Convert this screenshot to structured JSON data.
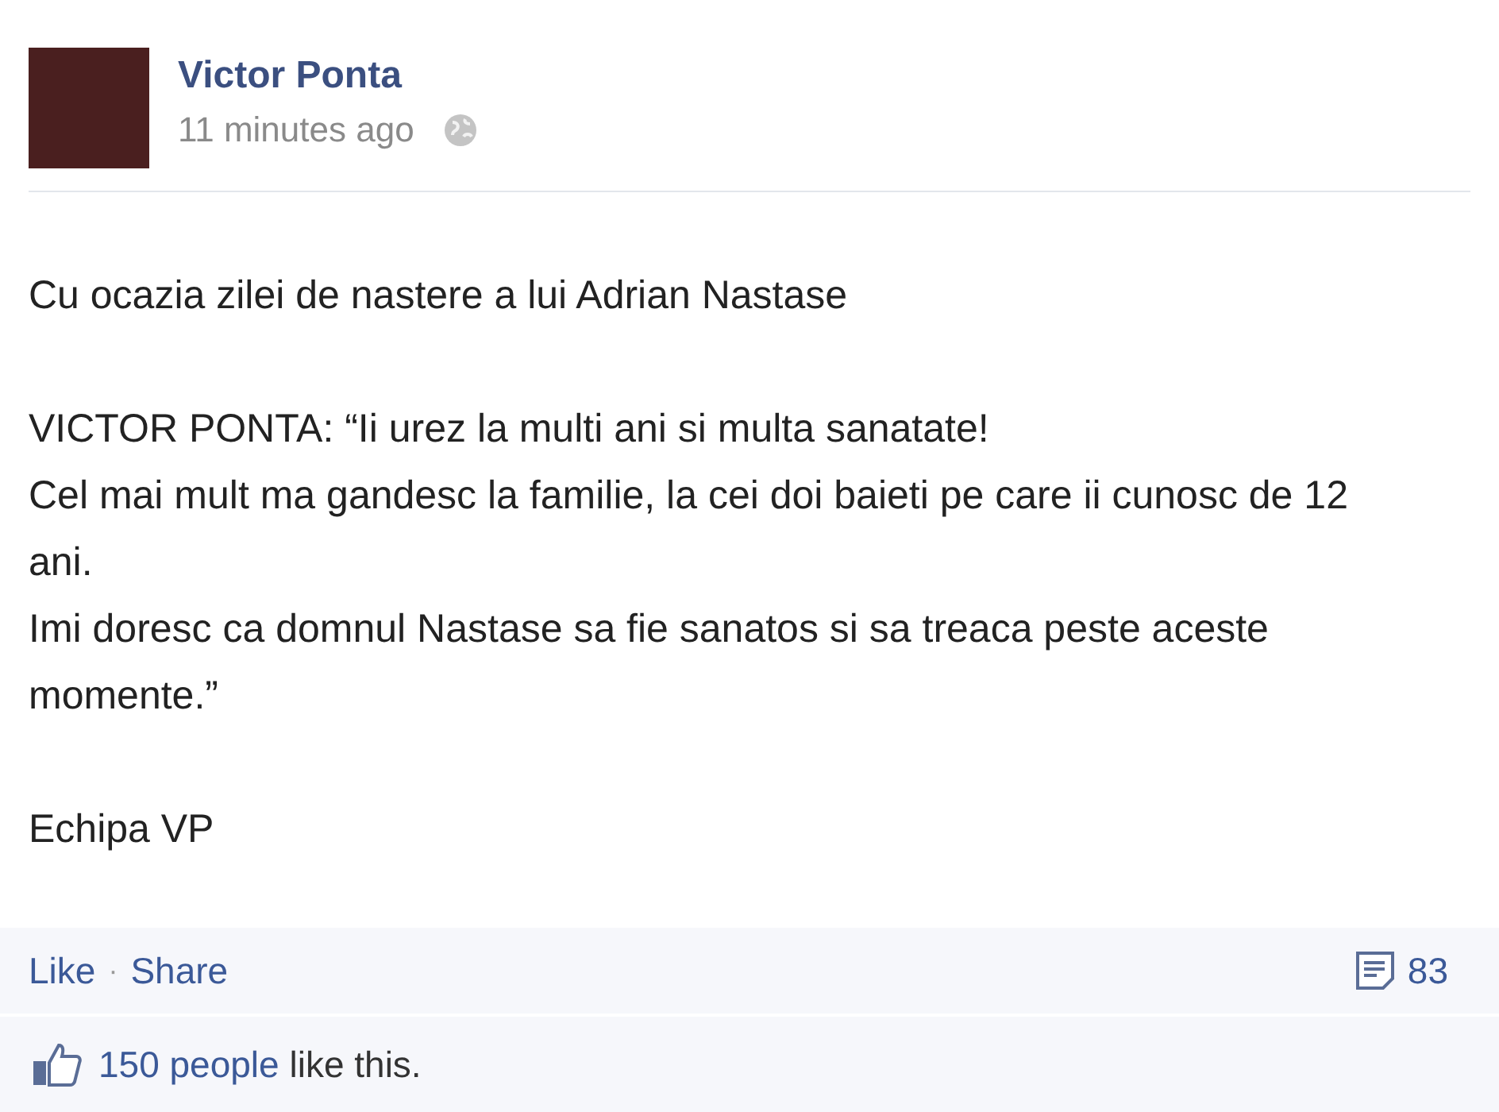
{
  "post": {
    "author": "Victor Ponta",
    "time": "11 minutes ago",
    "paragraphs": [
      [
        "Cu ocazia zilei de nastere a lui Adrian Nastase"
      ],
      [
        "VICTOR PONTA: “Ii urez la multi ani si multa sanatate!",
        "Cel mai mult ma gandesc la familie, la cei doi baieti pe care ii cunosc de 12 ani.",
        "Imi doresc ca domnul Nastase sa fie sanatos si sa treaca peste aceste momente.”"
      ],
      [
        "Echipa VP"
      ]
    ]
  },
  "actions": {
    "like": "Like",
    "separator": "·",
    "share": "Share",
    "comments": "83"
  },
  "likes": {
    "link": "150 people",
    "text": "like this."
  }
}
